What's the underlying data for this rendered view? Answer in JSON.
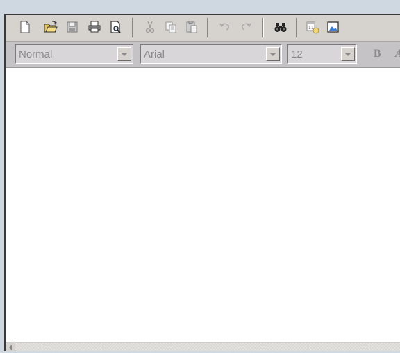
{
  "toolbar": {
    "buttons": [
      {
        "icon": "new-document-icon"
      },
      {
        "icon": "open-folder-icon"
      },
      {
        "icon": "save-icon"
      },
      {
        "icon": "print-icon"
      },
      {
        "icon": "print-preview-icon"
      },
      {
        "icon": "cut-icon"
      },
      {
        "icon": "copy-icon"
      },
      {
        "icon": "paste-icon"
      },
      {
        "icon": "undo-icon"
      },
      {
        "icon": "redo-icon"
      },
      {
        "icon": "find-icon"
      },
      {
        "icon": "insert-date-icon"
      },
      {
        "icon": "insert-picture-icon"
      }
    ]
  },
  "format": {
    "style_value": "Normal",
    "font_value": "Arial",
    "size_value": "12",
    "bold_label": "B",
    "italic_label": "A"
  },
  "colors": {
    "toolbar_bg": "#d6d3ce",
    "formatbar_bg": "#c6c3c6",
    "disabled_text": "#8a8a8a",
    "editor_bg": "#ffffff",
    "page_bg": "#cfd8e0"
  }
}
